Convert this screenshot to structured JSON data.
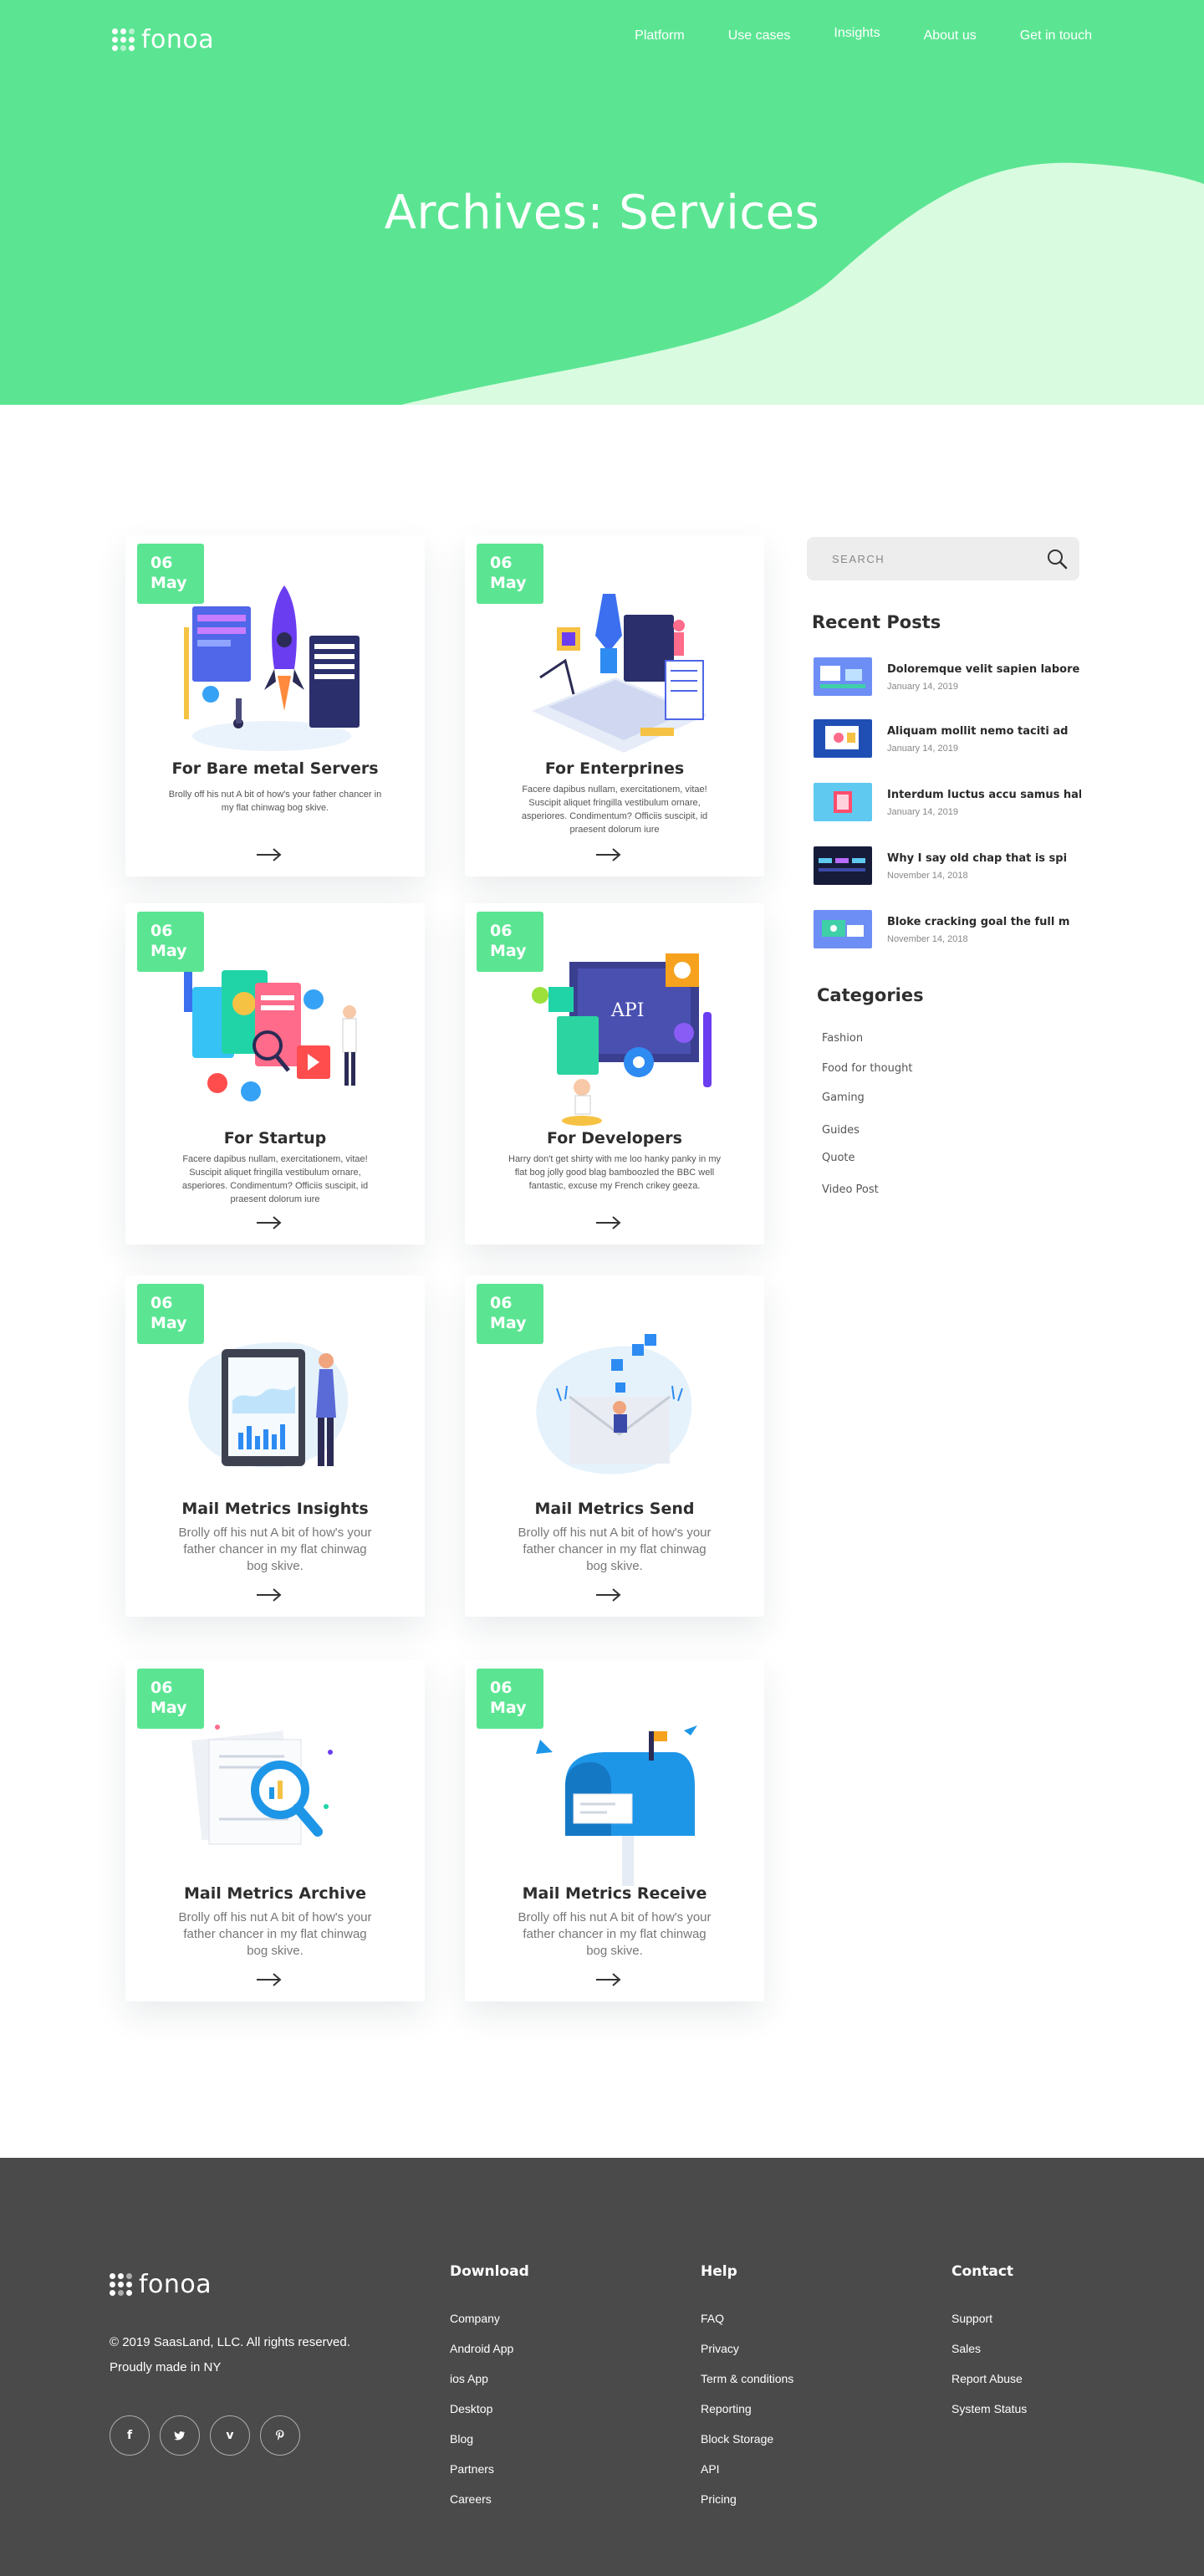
{
  "brand": {
    "name": "fonoa",
    "accent": "#5be592",
    "accent_light": "#d9fbe0",
    "footer_bg": "#4a4a4a"
  },
  "nav": {
    "items": [
      "Platform",
      "Use cases",
      "Insights",
      "About us",
      "Get in touch"
    ]
  },
  "hero": {
    "title": "Archives: Services"
  },
  "cards": [
    {
      "day": "06",
      "month": "May",
      "title": "For Bare metal Servers",
      "text": "Brolly off his nut A bit of how's your father chancer in my flat chinwag bog skive.",
      "illustration": "rocket-launch-illustration"
    },
    {
      "day": "06",
      "month": "May",
      "title": "For Enterprines",
      "text": "Facere dapibus nullam, exercitationem, vitae! Suscipit aliquet fringilla vestibulum ornare, asperiores. Condimentum? Officiis suscipit, id praesent dolorum iure",
      "illustration": "pen-tool-laptop-illustration"
    },
    {
      "day": "06",
      "month": "May",
      "title": "For Startup",
      "text": "Facere dapibus nullam, exercitationem, vitae! Suscipit aliquet fringilla vestibulum ornare, asperiores. Condimentum? Officiis suscipit, id praesent dolorum iure",
      "illustration": "app-screens-illustration"
    },
    {
      "day": "06",
      "month": "May",
      "title": "For Developers",
      "text": "Harry don't get shirty with me loo hanky panky in my flat bog jolly good blag bamboozled the BBC well fantastic, excuse my French crikey geeza.",
      "illustration": "api-gears-illustration"
    },
    {
      "day": "06",
      "month": "May",
      "title": "Mail Metrics Insights",
      "text": "Brolly off his nut A bit of how's your father chancer in my flat chinwag bog skive.",
      "illustration": "tablet-chart-illustration"
    },
    {
      "day": "06",
      "month": "May",
      "title": "Mail Metrics Send",
      "text": "Brolly off his nut A bit of how's your father chancer in my flat chinwag bog skive.",
      "illustration": "envelope-send-illustration"
    },
    {
      "day": "06",
      "month": "May",
      "title": "Mail Metrics Archive",
      "text": "Brolly off his nut A bit of how's your father chancer in my flat chinwag bog skive.",
      "illustration": "magnifier-documents-illustration"
    },
    {
      "day": "06",
      "month": "May",
      "title": "Mail Metrics Receive",
      "text": "Brolly off his nut A bit of how's your father chancer in my flat chinwag bog skive.",
      "illustration": "mailbox-illustration"
    }
  ],
  "sidebar": {
    "search_placeholder": "SEARCH",
    "recent_heading": "Recent Posts",
    "recent_posts": [
      {
        "title": "Doloremque velit sapien labore",
        "date": "January 14, 2019"
      },
      {
        "title": "Aliquam mollit nemo taciti ad",
        "date": "January 14, 2019"
      },
      {
        "title": "Interdum luctus accu samus hab",
        "date": "January 14, 2019"
      },
      {
        "title": "Why I say old chap that is spi",
        "date": "November 14, 2018"
      },
      {
        "title": "Bloke cracking goal the full m",
        "date": "November 14, 2018"
      }
    ],
    "categories_heading": "Categories",
    "categories": [
      "Fashion",
      "Food for thought",
      "Gaming",
      "Guides",
      "Quote",
      "Video Post"
    ]
  },
  "footer": {
    "copyright": "© 2019 SaasLand, LLC. All rights reserved.",
    "made_in": "Proudly made in NY",
    "socials": [
      "facebook-icon",
      "twitter-icon",
      "vimeo-icon",
      "pinterest-icon"
    ],
    "columns": [
      {
        "heading": "Download",
        "links": [
          "Company",
          "Android App",
          "ios App",
          "Desktop",
          "Blog",
          "Partners",
          "Careers"
        ]
      },
      {
        "heading": "Help",
        "links": [
          "FAQ",
          "Privacy",
          "Term & conditions",
          "Reporting",
          "Block Storage",
          "API",
          "Pricing"
        ]
      },
      {
        "heading": "Contact",
        "links": [
          "Support",
          "Sales",
          "Report Abuse",
          "System Status"
        ]
      }
    ]
  }
}
